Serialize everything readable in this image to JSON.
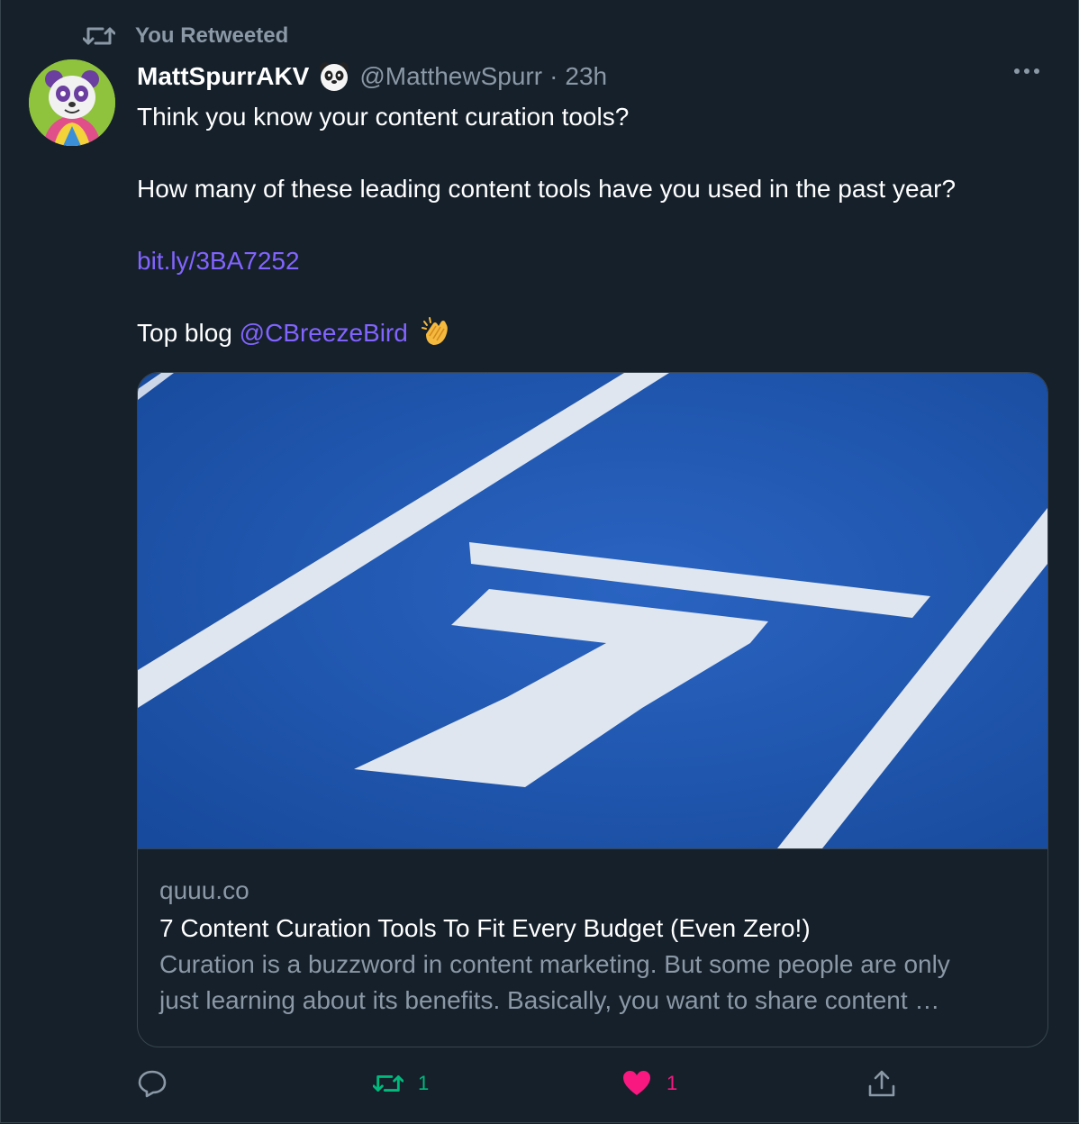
{
  "retweet_context": {
    "label": "You Retweeted",
    "icon": "retweet-icon"
  },
  "author": {
    "display_name": "MattSpurrAKV",
    "badge_icon": "panda-emoji-icon",
    "handle": "@MatthewSpurr",
    "separator": "·",
    "time": "23h",
    "avatar_icon": "panda-avatar-icon"
  },
  "tweet": {
    "line1": "Think you know your content curation tools?",
    "line2": "How many of these leading content tools have you used in the past year?",
    "link": "bit.ly/3BA7252",
    "line4_prefix": "Top blog",
    "mention": "@CBreezeBird",
    "emoji_icon": "clapping-hands-icon"
  },
  "card": {
    "image_icon": "running-track-lane-7-image",
    "domain": "quuu.co",
    "title": "7 Content Curation Tools To Fit Every Budget (Even Zero!)",
    "description_line1": "Curation is a buzzword in content marketing. But some people are only",
    "description_line2": "just learning about its benefits. Basically, you want to share content …"
  },
  "actions": {
    "reply_icon": "reply-icon",
    "retweet_count": "1",
    "like_count": "1",
    "share_icon": "share-icon"
  },
  "colors": {
    "background": "#15202b",
    "link": "#8264ff",
    "retweet_active": "#00ba7c",
    "like_active": "#f91880",
    "muted": "#8b98a5"
  }
}
